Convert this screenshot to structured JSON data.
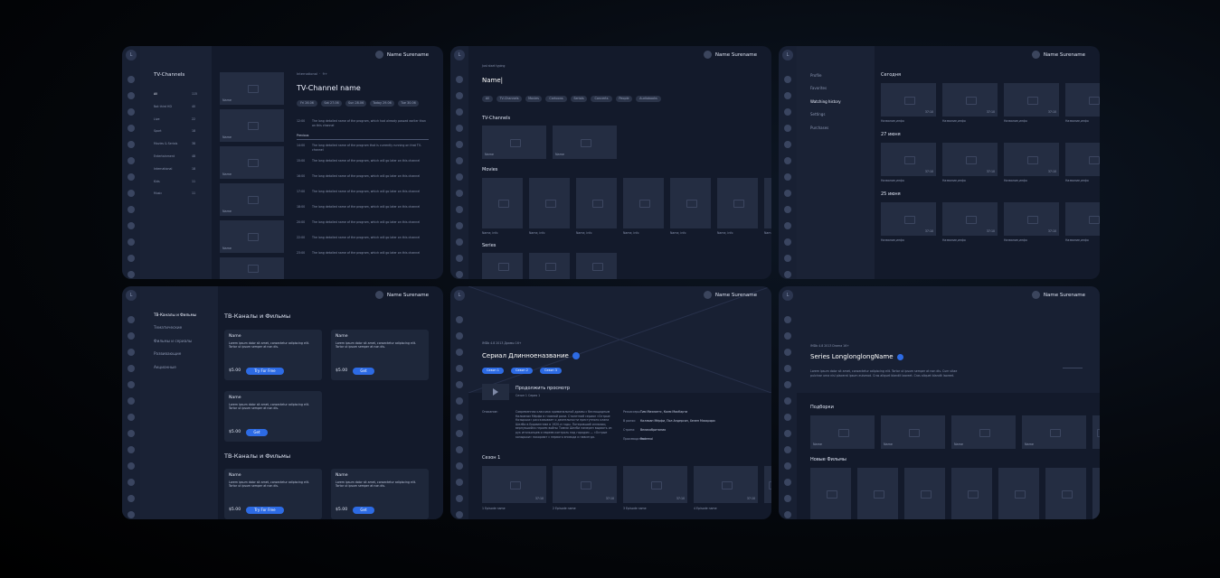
{
  "user": {
    "name": "Name Surename"
  },
  "logo_letter": "L",
  "tv": {
    "sidebar_title": "TV-Channels",
    "categories": [
      {
        "label": "All",
        "count": "115"
      },
      {
        "label": "Not third HD",
        "count": "40"
      },
      {
        "label": "Live",
        "count": "22"
      },
      {
        "label": "Sport",
        "count": "18"
      },
      {
        "label": "Movies & Serials",
        "count": "38"
      },
      {
        "label": "Entertainment",
        "count": "48"
      },
      {
        "label": "International",
        "count": "18"
      },
      {
        "label": "Kids",
        "count": "11"
      },
      {
        "label": "Music",
        "count": "11"
      }
    ],
    "channel_thumbs": [
      "Name",
      "Name",
      "Name",
      "Name",
      "Name"
    ],
    "breadcrumb": [
      "International",
      "9+"
    ],
    "title": "TV-Channel name",
    "days": [
      "Fri 26.06",
      "Sat 27.06",
      "Sun 28.06",
      "Today 29.06",
      "Tue 30.06"
    ],
    "now_time": "12:00",
    "now_text": "The long detailed name of the program, which had already passed earlier than on this channel",
    "previous_label": "Previous",
    "programs": [
      {
        "time": "14:00",
        "text": "The long detailed name of the program that is currently running on that TV-channel"
      },
      {
        "time": "15:00",
        "text": "The long detailed name of the program, which will go later on this channel"
      },
      {
        "time": "16:00",
        "text": "The long detailed name of the program, which will go later on this channel"
      },
      {
        "time": "17:00",
        "text": "The long detailed name of the program, which will go later on this channel"
      },
      {
        "time": "18:00",
        "text": "The long detailed name of the program, which will go later on this channel"
      },
      {
        "time": "20:00",
        "text": "The long detailed name of the program, which will go later on this channel"
      },
      {
        "time": "22:00",
        "text": "The long detailed name of the program, which will go later on this channel"
      },
      {
        "time": "23:00",
        "text": "The long detailed name of the program, which will go later on this channel"
      }
    ]
  },
  "search": {
    "hint": "Just start typing",
    "query": "Name",
    "filters": [
      "All",
      "TV-Channels",
      "Movies",
      "Cartoons",
      "Serials",
      "Concerts",
      "People",
      "Audiobooks"
    ],
    "tv_title": "TV-Channels",
    "tv_items": [
      "Name",
      "Name"
    ],
    "movies_title": "Movies",
    "movie_items": [
      "Name, info",
      "Name, info",
      "Name, info",
      "Name, info",
      "Name, info",
      "Name, info",
      "Nam"
    ],
    "series_title": "Series"
  },
  "history": {
    "menu": [
      "Profile",
      "Favorites",
      "Watching history",
      "Settings",
      "Purchases"
    ],
    "sections": [
      {
        "title": "Сегодня"
      },
      {
        "title": "27 июня"
      },
      {
        "title": "25 июня"
      }
    ],
    "item_caption": "Название,инфо",
    "duration": "37:10"
  },
  "subs": {
    "menu": [
      "ТВ-Каналы и Фильмы",
      "Тематические",
      "Фильмы и сериалы",
      "Развивающие",
      "Акционные"
    ],
    "section_title": "ТВ-Каналы и Фильмы",
    "card_title": "Name",
    "card_text": "Lorem ipsum dolor sit amet, consectetur adipiscing elit. Tortor ut ipsum semper at non dis.",
    "price": "$5.00",
    "try_label": "Try For Free",
    "get_label": "Get"
  },
  "series": {
    "meta": [
      "IMDb 4.8",
      "2013",
      "Драмы",
      "16+"
    ],
    "title": "Сериал Длинноеназвание",
    "seasons": [
      "Сезон 1",
      "Сезон 2",
      "Сезон 3"
    ],
    "continue_title": "Продолжить просмотр",
    "continue_sub": "Сезон 1 Серия 1",
    "desc_label": "Описание:",
    "desc": "Современная классика криминальной драмы с беспощадным Килианом Мёрфи в главной роли. Столетний сериал «Острые Козырьки» рассказывает о деятельности преступного клана Шелби в Бирмингеме в 1920-е годы. Потерявший иллюзии, вернувшийся героем войны Томми Шелби намерен вырвать из рук итальянцев и евреев контроль над городом — «Острые козырьки» покоряют с первого эпизода и навсегда.",
    "credits": [
      {
        "k": "Режиссеры:",
        "v": "Тим Миэлантс, Колм МакКарти"
      },
      {
        "k": "В ролях:",
        "v": "Киллиан Мёрфи, Пол Андерсон, Хелен Маккрори"
      },
      {
        "k": "Страна:",
        "v": "Великобритания"
      },
      {
        "k": "Производство:",
        "v": "Endemol"
      }
    ],
    "season_title": "Сезон 1",
    "episodes": [
      "1 Episode name",
      "2 Episode name",
      "3 Episode name",
      "4 Episode name"
    ],
    "ep_duration": "37:10"
  },
  "series2": {
    "meta": [
      "IMDb 4.8",
      "2013",
      "Drama",
      "16+"
    ],
    "title": "Series LonglonglongName",
    "desc": "Lorem ipsum dolor sit amet, consectetur adipiscing elit. Tortor ut ipsum semper at non dis. Cum vitae pulvinar urna nisl placerat ipsum euismod. Cras aliquet blandit laoreet. Cras aliquet blandit laoreet.",
    "picks_title": "Подборки",
    "picks": [
      "Name",
      "Name",
      "Name",
      "Name"
    ],
    "new_title": "Новые Фильмы"
  }
}
